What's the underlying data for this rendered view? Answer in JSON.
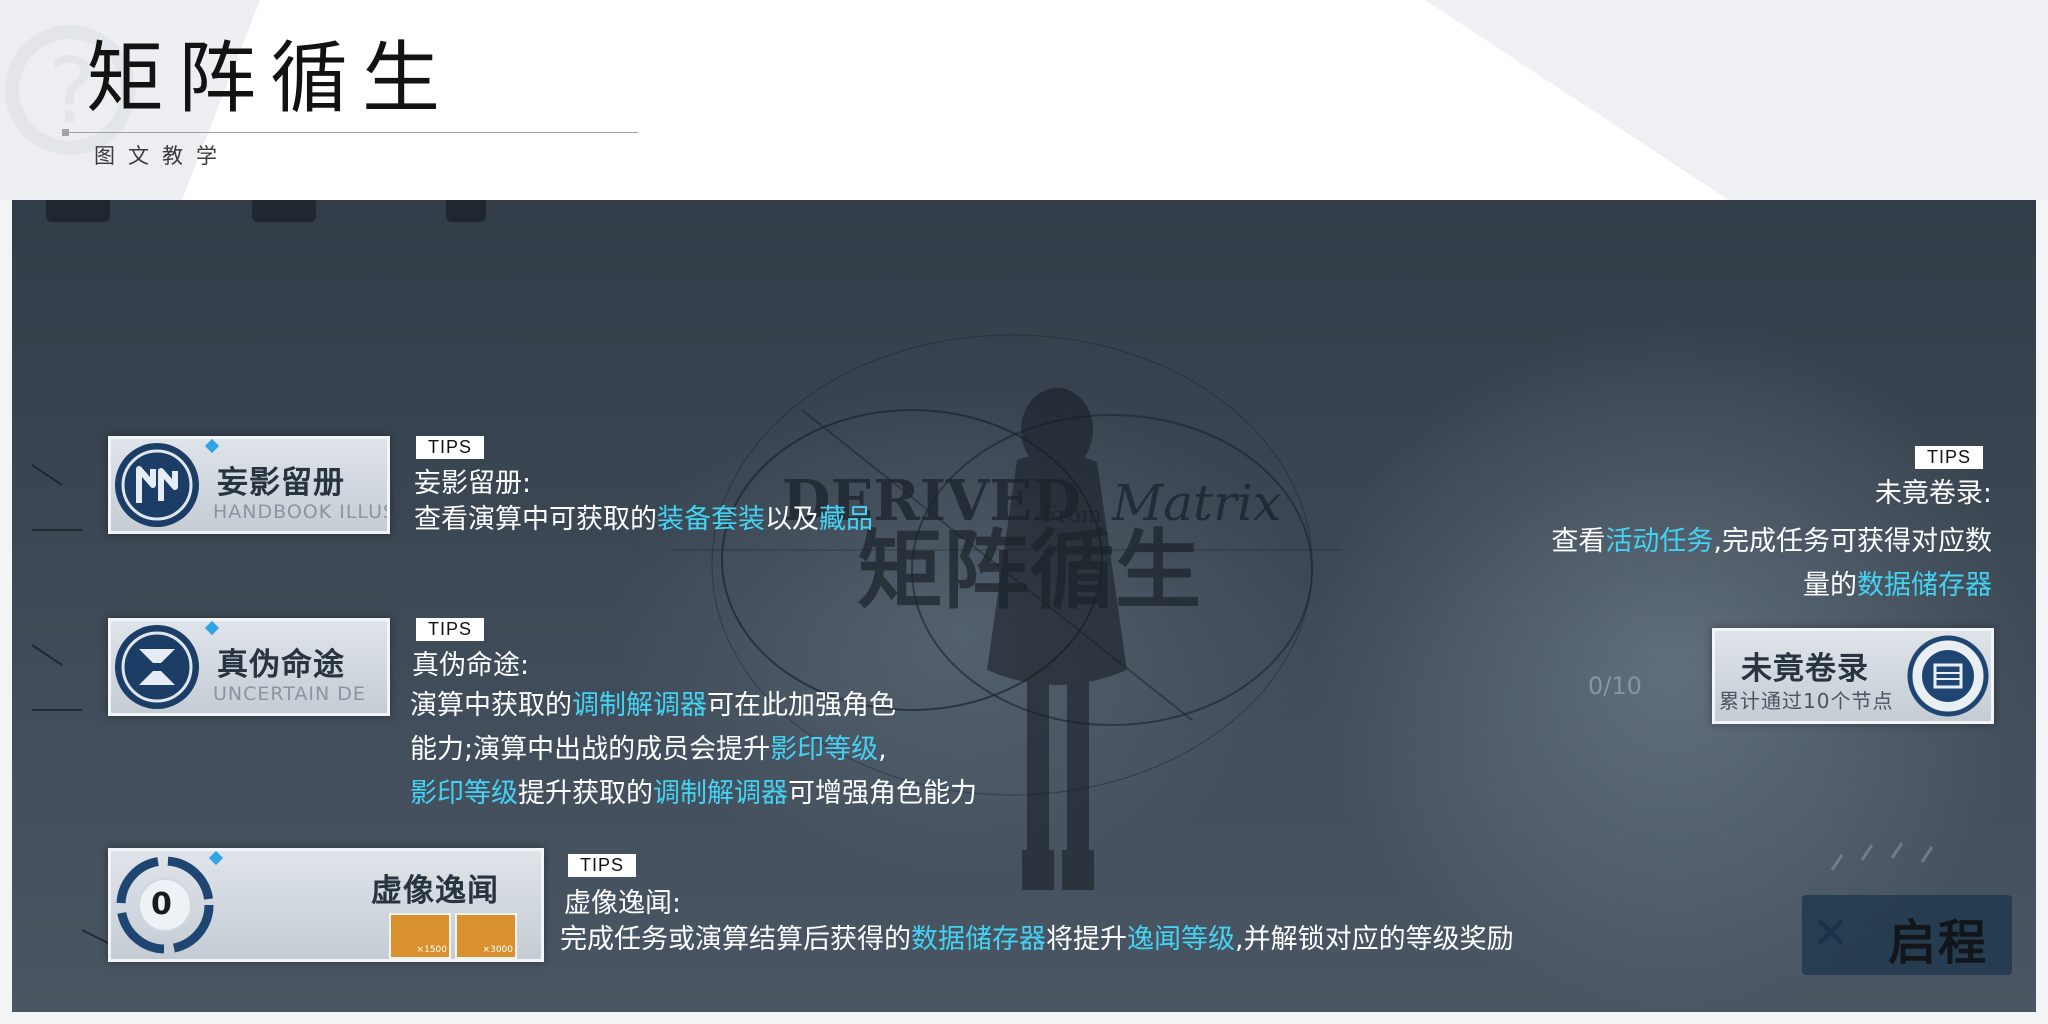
{
  "header": {
    "title": "矩阵循生",
    "subtitle": "图文教学"
  },
  "background": {
    "watermark_en": "DERIVED",
    "watermark_from": "From",
    "watermark_matrix": "Matrix",
    "watermark_cn": "矩阵循生"
  },
  "cards": {
    "handbook": {
      "title": "妄影留册",
      "sub": "HANDBOOK ILLUSI"
    },
    "uncertain": {
      "title": "真伪命途",
      "sub": "UNCERTAIN DE"
    },
    "rumor": {
      "title": "虚像逸闻",
      "level": "0",
      "reward1": "×1500",
      "reward2": "×3000"
    },
    "records": {
      "title": "未竟卷录",
      "sub": "累计通过10个节点",
      "progress": "0/10"
    }
  },
  "tips_label": "TIPS",
  "handbook_tip": {
    "heading": "妄影留册:",
    "l1_a": "查看演算中可获取的",
    "l1_hl1": "装备套装",
    "l1_b": "以及",
    "l1_hl2": "藏品"
  },
  "uncertain_tip": {
    "heading": "真伪命途:",
    "l1_a": "演算中获取的",
    "l1_hl": "调制解调器",
    "l1_b": "可在此加强角色",
    "l2_a": "能力;演算中出战的成员会提升",
    "l2_hl": "影印等级",
    "l2_b": ",",
    "l3_hl1": "影印等级",
    "l3_a": "提升获取的",
    "l3_hl2": "调制解调器",
    "l3_b": "可增强角色能力"
  },
  "rumor_tip": {
    "heading": "虚像逸闻:",
    "l1_a": "完成任务或演算结算后获得的",
    "l1_hl1": "数据储存器",
    "l1_b": "将提升",
    "l1_hl2": "逸闻等级",
    "l1_c": ",并解锁对应的等级奖励"
  },
  "records_tip": {
    "heading": "未竟卷录:",
    "l1_a": "查看",
    "l1_hl": "活动任务",
    "l1_b": ",完成任务可获得对应数",
    "l2_a": "量的",
    "l2_hl": "数据储存器"
  },
  "start_button": {
    "label": "启程"
  },
  "colors": {
    "highlight": "#44d2f3",
    "panel": "#3b4753",
    "card_title": "#293441"
  }
}
